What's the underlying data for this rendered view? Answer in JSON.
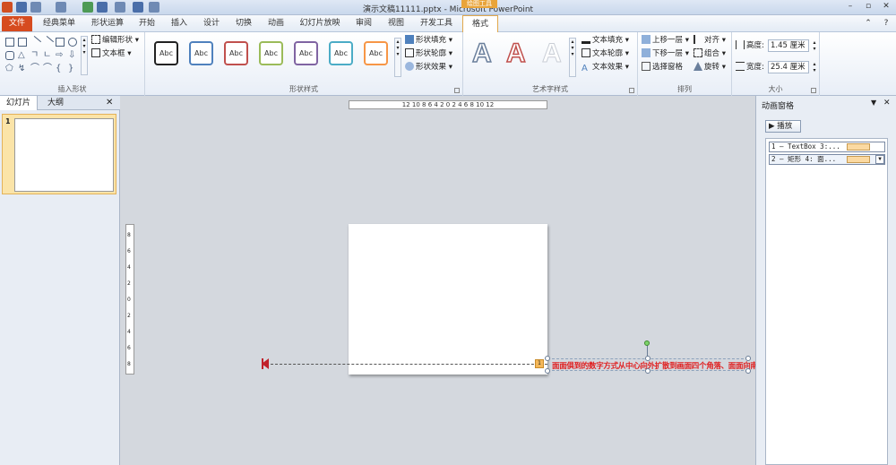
{
  "titlebar": {
    "title": "演示文稿11111.pptx - Microsoft PowerPoint",
    "context_tab": "绘图工具"
  },
  "tabs": [
    "文件",
    "经典菜单",
    "形状运算",
    "开始",
    "插入",
    "设计",
    "切换",
    "动画",
    "幻灯片放映",
    "审阅",
    "视图",
    "开发工具",
    "格式"
  ],
  "ribbon": {
    "insert_shapes": {
      "label": "插入形状",
      "edit_shape": "编辑形状",
      "textbox": "文本框"
    },
    "shape_styles": {
      "label": "形状样式",
      "samples": [
        "Abc",
        "Abc",
        "Abc",
        "Abc",
        "Abc",
        "Abc",
        "Abc"
      ],
      "fill": "形状填充",
      "outline": "形状轮廓",
      "effects": "形状效果"
    },
    "wordart": {
      "label": "艺术字样式",
      "samples": [
        "A",
        "A",
        "A"
      ],
      "text_fill": "文本填充",
      "text_outline": "文本轮廓",
      "text_effects": "文本效果"
    },
    "arrange": {
      "label": "排列",
      "bring_forward": "上移一层",
      "send_backward": "下移一层",
      "selection_pane": "选择窗格",
      "align": "对齐",
      "group": "组合",
      "rotate": "旋转"
    },
    "size": {
      "label": "大小",
      "height_label": "高度:",
      "height_value": "1.45 厘米",
      "width_label": "宽度:",
      "width_value": "25.4 厘米"
    }
  },
  "left_panel": {
    "tabs": [
      "幻灯片",
      "大纲"
    ],
    "slide_number": "1"
  },
  "ruler": {
    "horizontal": "12 10 8 6 4 2 0 2 4 6 8 10 12",
    "vertical": [
      "8",
      "6",
      "4",
      "2",
      "0",
      "2",
      "4",
      "6",
      "8"
    ]
  },
  "slide": {
    "textbox_text": "面面俱到的数字方式从中心向外扩散到画面四个角落、面面向南的几方",
    "anim_tag": "1"
  },
  "animation_pane": {
    "title": "动画窗格",
    "play": "播放",
    "items": [
      {
        "label": "1 — TextBox 3:..."
      },
      {
        "label": "2 — 矩形 4: 面..."
      }
    ]
  },
  "colors": {
    "file_tab": "#d64b1f",
    "context_tab": "#e9a43a",
    "textbox_text": "#e02020",
    "anim_bar": "#fbd9a1"
  }
}
